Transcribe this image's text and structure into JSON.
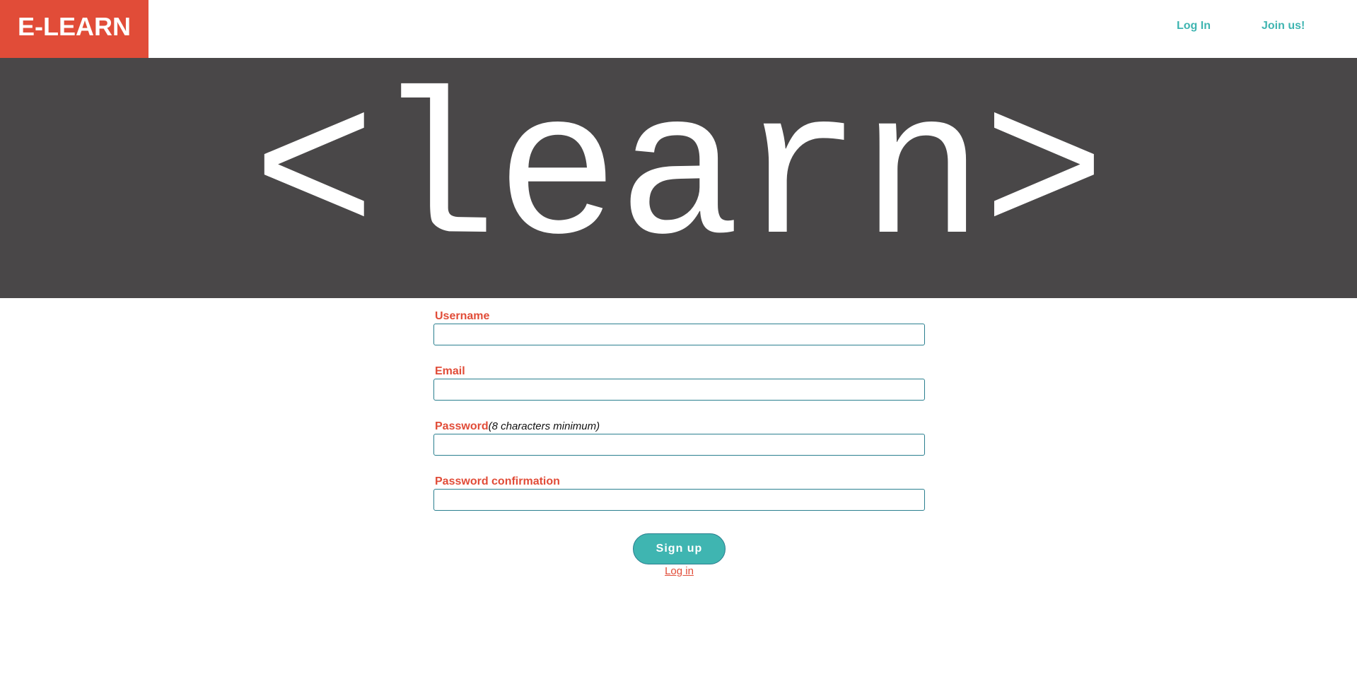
{
  "navbar": {
    "brand": "E-LEARN",
    "links": {
      "login": "Log In",
      "join": "Join us!"
    }
  },
  "hero": {
    "text": "<learn>"
  },
  "form": {
    "fields": {
      "username": {
        "label": "Username",
        "value": "",
        "placeholder": ""
      },
      "email": {
        "label": "Email",
        "value": "",
        "placeholder": ""
      },
      "password": {
        "label": "Password",
        "hint": "(8 characters minimum)",
        "value": "",
        "placeholder": ""
      },
      "password_confirmation": {
        "label": "Password confirmation",
        "value": "",
        "placeholder": ""
      }
    },
    "submit_label": "Sign up",
    "login_link": "Log in"
  },
  "colors": {
    "brand": "#e14c38",
    "accent": "#3fb5b1",
    "hero_background": "#494748",
    "input_border": "#2a7f8f"
  }
}
